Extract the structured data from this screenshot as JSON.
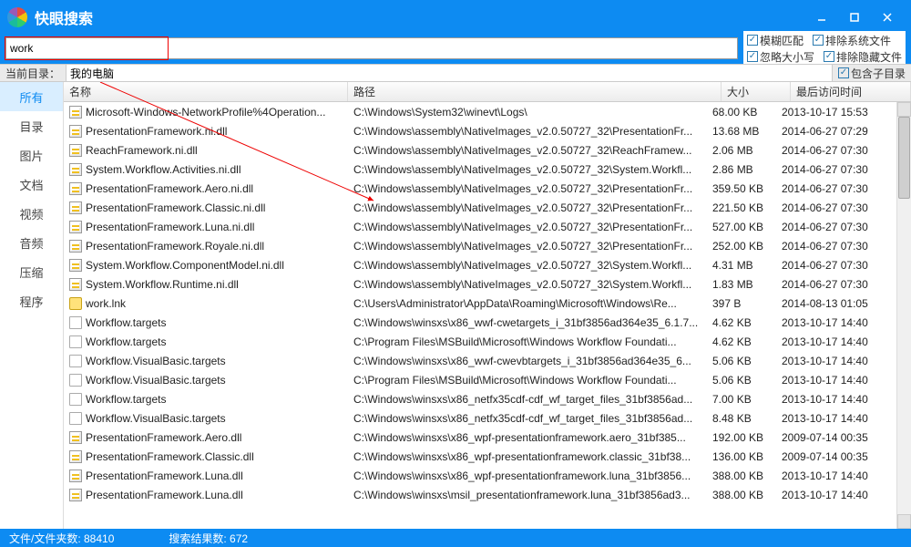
{
  "titlebar": {
    "title": "快眼搜索"
  },
  "search": {
    "value": "work"
  },
  "filters": {
    "fuzzy": "模糊匹配",
    "exclude_sys": "排除系统文件",
    "ignore_case": "忽略大小写",
    "exclude_hidden": "排除隐藏文件"
  },
  "dirbar": {
    "label": "当前目录：",
    "value": "我的电脑",
    "include_sub": "包含子目录"
  },
  "sidebar": {
    "tabs": [
      "所有",
      "目录",
      "图片",
      "文档",
      "视频",
      "音频",
      "压缩",
      "程序"
    ]
  },
  "columns": {
    "name": "名称",
    "path": "路径",
    "size": "大小",
    "date": "最后访问时间"
  },
  "rows": [
    {
      "icon": "dll",
      "name": "Microsoft-Windows-NetworkProfile%4Operation...",
      "path": "C:\\Windows\\System32\\winevt\\Logs\\",
      "size": "68.00 KB",
      "date": "2013-10-17 15:53"
    },
    {
      "icon": "dll",
      "name": "PresentationFramework.ni.dll",
      "path": "C:\\Windows\\assembly\\NativeImages_v2.0.50727_32\\PresentationFr...",
      "size": "13.68 MB",
      "date": "2014-06-27 07:29"
    },
    {
      "icon": "dll",
      "name": "ReachFramework.ni.dll",
      "path": "C:\\Windows\\assembly\\NativeImages_v2.0.50727_32\\ReachFramew...",
      "size": "2.06 MB",
      "date": "2014-06-27 07:30"
    },
    {
      "icon": "dll",
      "name": "System.Workflow.Activities.ni.dll",
      "path": "C:\\Windows\\assembly\\NativeImages_v2.0.50727_32\\System.Workfl...",
      "size": "2.86 MB",
      "date": "2014-06-27 07:30"
    },
    {
      "icon": "dll",
      "name": "PresentationFramework.Aero.ni.dll",
      "path": "C:\\Windows\\assembly\\NativeImages_v2.0.50727_32\\PresentationFr...",
      "size": "359.50 KB",
      "date": "2014-06-27 07:30"
    },
    {
      "icon": "dll",
      "name": "PresentationFramework.Classic.ni.dll",
      "path": "C:\\Windows\\assembly\\NativeImages_v2.0.50727_32\\PresentationFr...",
      "size": "221.50 KB",
      "date": "2014-06-27 07:30"
    },
    {
      "icon": "dll",
      "name": "PresentationFramework.Luna.ni.dll",
      "path": "C:\\Windows\\assembly\\NativeImages_v2.0.50727_32\\PresentationFr...",
      "size": "527.00 KB",
      "date": "2014-06-27 07:30"
    },
    {
      "icon": "dll",
      "name": "PresentationFramework.Royale.ni.dll",
      "path": "C:\\Windows\\assembly\\NativeImages_v2.0.50727_32\\PresentationFr...",
      "size": "252.00 KB",
      "date": "2014-06-27 07:30"
    },
    {
      "icon": "dll",
      "name": "System.Workflow.ComponentModel.ni.dll",
      "path": "C:\\Windows\\assembly\\NativeImages_v2.0.50727_32\\System.Workfl...",
      "size": "4.31 MB",
      "date": "2014-06-27 07:30"
    },
    {
      "icon": "dll",
      "name": "System.Workflow.Runtime.ni.dll",
      "path": "C:\\Windows\\assembly\\NativeImages_v2.0.50727_32\\System.Workfl...",
      "size": "1.83 MB",
      "date": "2014-06-27 07:30"
    },
    {
      "icon": "lnk",
      "name": "work.lnk",
      "path": "C:\\Users\\Administrator\\AppData\\Roaming\\Microsoft\\Windows\\Re...",
      "size": "397 B",
      "date": "2014-08-13 01:05"
    },
    {
      "icon": "file",
      "name": "Workflow.targets",
      "path": "C:\\Windows\\winsxs\\x86_wwf-cwetargets_i_31bf3856ad364e35_6.1.7...",
      "size": "4.62 KB",
      "date": "2013-10-17 14:40"
    },
    {
      "icon": "file",
      "name": "Workflow.targets",
      "path": "C:\\Program Files\\MSBuild\\Microsoft\\Windows Workflow Foundati...",
      "size": "4.62 KB",
      "date": "2013-10-17 14:40"
    },
    {
      "icon": "file",
      "name": "Workflow.VisualBasic.targets",
      "path": "C:\\Windows\\winsxs\\x86_wwf-cwevbtargets_i_31bf3856ad364e35_6...",
      "size": "5.06 KB",
      "date": "2013-10-17 14:40"
    },
    {
      "icon": "file",
      "name": "Workflow.VisualBasic.targets",
      "path": "C:\\Program Files\\MSBuild\\Microsoft\\Windows Workflow Foundati...",
      "size": "5.06 KB",
      "date": "2013-10-17 14:40"
    },
    {
      "icon": "file",
      "name": "Workflow.targets",
      "path": "C:\\Windows\\winsxs\\x86_netfx35cdf-cdf_wf_target_files_31bf3856ad...",
      "size": "7.00 KB",
      "date": "2013-10-17 14:40"
    },
    {
      "icon": "file",
      "name": "Workflow.VisualBasic.targets",
      "path": "C:\\Windows\\winsxs\\x86_netfx35cdf-cdf_wf_target_files_31bf3856ad...",
      "size": "8.48 KB",
      "date": "2013-10-17 14:40"
    },
    {
      "icon": "dll",
      "name": "PresentationFramework.Aero.dll",
      "path": "C:\\Windows\\winsxs\\x86_wpf-presentationframework.aero_31bf385...",
      "size": "192.00 KB",
      "date": "2009-07-14 00:35"
    },
    {
      "icon": "dll",
      "name": "PresentationFramework.Classic.dll",
      "path": "C:\\Windows\\winsxs\\x86_wpf-presentationframework.classic_31bf38...",
      "size": "136.00 KB",
      "date": "2009-07-14 00:35"
    },
    {
      "icon": "dll",
      "name": "PresentationFramework.Luna.dll",
      "path": "C:\\Windows\\winsxs\\x86_wpf-presentationframework.luna_31bf3856...",
      "size": "388.00 KB",
      "date": "2013-10-17 14:40"
    },
    {
      "icon": "dll",
      "name": "PresentationFramework.Luna.dll",
      "path": "C:\\Windows\\winsxs\\msil_presentationframework.luna_31bf3856ad3...",
      "size": "388.00 KB",
      "date": "2013-10-17 14:40"
    }
  ],
  "status": {
    "files": "文件/文件夹数: 88410",
    "results": "搜索结果数: 672"
  }
}
